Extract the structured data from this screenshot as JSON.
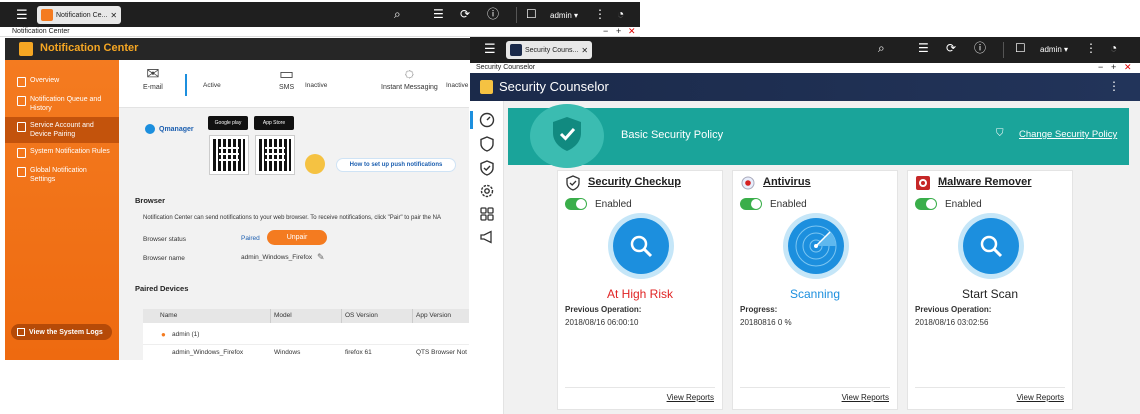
{
  "nc_window": {
    "tab_title": "Notification Ce...",
    "user": "admin",
    "window_title": "Notification Center",
    "app_title": "Notification Center",
    "sidebar": [
      {
        "label": "Overview"
      },
      {
        "label": "Notification Queue and History"
      },
      {
        "label": "Service Account and Device Pairing"
      },
      {
        "label": "System Notification Rules"
      },
      {
        "label": "Global Notification Settings"
      }
    ],
    "logs_button": "View the System Logs",
    "channels": [
      {
        "label": "E-mail",
        "state": "Active"
      },
      {
        "label": "SMS",
        "state": "Inactive"
      },
      {
        "label": "Instant Messaging",
        "state": "Inactive"
      }
    ],
    "qmanager": "Qmanager",
    "google_play": "Google play",
    "app_store": "App Store",
    "push_link": "How to set up push notifications",
    "browser_heading": "Browser",
    "browser_desc": "Notification Center can send notifications to your web browser. To receive notifications, click \"Pair\" to pair the NA",
    "browser_status_label": "Browser status",
    "browser_status_value": "Paired",
    "unpair_button": "Unpair",
    "browser_name_label": "Browser name",
    "browser_name_value": "admin_Windows_Firefox",
    "paired_heading": "Paired Devices",
    "table_headers": [
      "Name",
      "Model",
      "OS Version",
      "App Version"
    ],
    "group_row": "admin (1)",
    "device_row": [
      "admin_Windows_Firefox",
      "Windows",
      "firefox 61",
      "QTS Browser Not"
    ]
  },
  "sc_window": {
    "tab_title": "Security Couns...",
    "user": "admin",
    "window_title": "Security Counselor",
    "app_title": "Security Counselor",
    "banner_title": "Basic Security Policy",
    "change_policy": "Change Security Policy",
    "cards": [
      {
        "title": "Security Checkup",
        "enabled": "Enabled",
        "status": "At High Risk",
        "status_color": "#e02424",
        "op_label": "Previous Operation:",
        "op_value": "2018/08/16 06:00:10",
        "reports": "View Reports"
      },
      {
        "title": "Antivirus",
        "enabled": "Enabled",
        "status": "Scanning",
        "status_color": "#1c8fde",
        "op_label": "Progress:",
        "op_value": "20180816 0 %",
        "reports": "View Reports"
      },
      {
        "title": "Malware Remover",
        "enabled": "Enabled",
        "status": "Start Scan",
        "status_color": "#222222",
        "op_label": "Previous Operation:",
        "op_value": "2018/08/16 03:02:56",
        "reports": "View Reports"
      }
    ]
  },
  "colors": {
    "nc_orange": "#f47b20",
    "sc_teal": "#1aa49a",
    "accent_blue": "#1c8fde",
    "enabled_green": "#3aae4a"
  },
  "icons": [
    "menu-icon",
    "search-icon",
    "stack-icon",
    "refresh-icon",
    "info-icon",
    "user-icon",
    "more-icon",
    "dashboard-icon",
    "shield-check-icon"
  ]
}
